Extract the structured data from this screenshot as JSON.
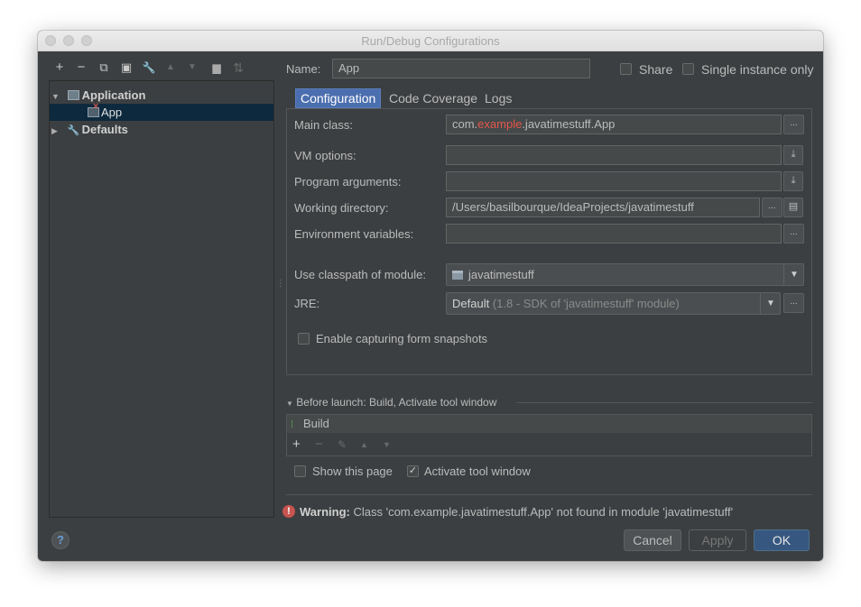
{
  "window": {
    "title": "Run/Debug Configurations"
  },
  "toolbar": {
    "add": "+",
    "remove": "−",
    "copy": "⧉",
    "save": "▣",
    "edit_defaults": "🔧",
    "move_up": "▲",
    "move_down": "▼",
    "folder": "▆",
    "sort": "⇅"
  },
  "tree": {
    "application": {
      "expander": "▼",
      "label": "Application"
    },
    "app": {
      "label": "App"
    },
    "defaults": {
      "expander": "▶",
      "label": "Defaults"
    }
  },
  "name": {
    "label": "Name:",
    "value": "App"
  },
  "share": {
    "label": "Share",
    "checked": false
  },
  "single_instance": {
    "label": "Single instance only",
    "checked": false
  },
  "tabs": [
    {
      "label": "Configuration",
      "active": true
    },
    {
      "label": "Code Coverage",
      "active": false
    },
    {
      "label": "Logs",
      "active": false
    }
  ],
  "config": {
    "main_class": {
      "label": "Main class:",
      "prefix": "com.",
      "highlight": "example",
      "suffix": ".javatimestuff.App",
      "button": "..."
    },
    "vm_options": {
      "label": "VM options:",
      "value": ""
    },
    "program_arguments": {
      "label": "Program arguments:",
      "value": ""
    },
    "working_directory": {
      "label": "Working directory:",
      "value": "/Users/basilbourque/IdeaProjects/javatimestuff",
      "button": "..."
    },
    "environment_variables": {
      "label": "Environment variables:",
      "value": "",
      "button": "..."
    },
    "classpath_module": {
      "label": "Use classpath of module:",
      "value": "javatimestuff"
    },
    "jre": {
      "label": "JRE:",
      "value": "Default",
      "detail": "(1.8 - SDK of 'javatimestuff' module)",
      "button": "..."
    },
    "enable_snapshots": {
      "label": "Enable capturing form snapshots",
      "checked": false
    }
  },
  "before_launch": {
    "header": "Before launch: Build, Activate tool window",
    "tasks": [
      {
        "label": "Build"
      }
    ],
    "actions": {
      "add": "+",
      "remove": "−",
      "edit": "✎",
      "up": "▲",
      "down": "▼"
    },
    "show_this_page": {
      "label": "Show this page",
      "checked": false
    },
    "activate_tool_window": {
      "label": "Activate tool window",
      "checked": true
    }
  },
  "warning": {
    "prefix": "Warning:",
    "text": "Class 'com.example.javatimestuff.App' not found in module 'javatimestuff'"
  },
  "buttons": {
    "help": "?",
    "cancel": "Cancel",
    "apply": "Apply",
    "ok": "OK"
  },
  "colors": {
    "background": "#3c3f41",
    "selection": "#0d293e",
    "accent": "#4b6eaf",
    "error": "#c75450",
    "highlight_text": "#e4564b"
  }
}
